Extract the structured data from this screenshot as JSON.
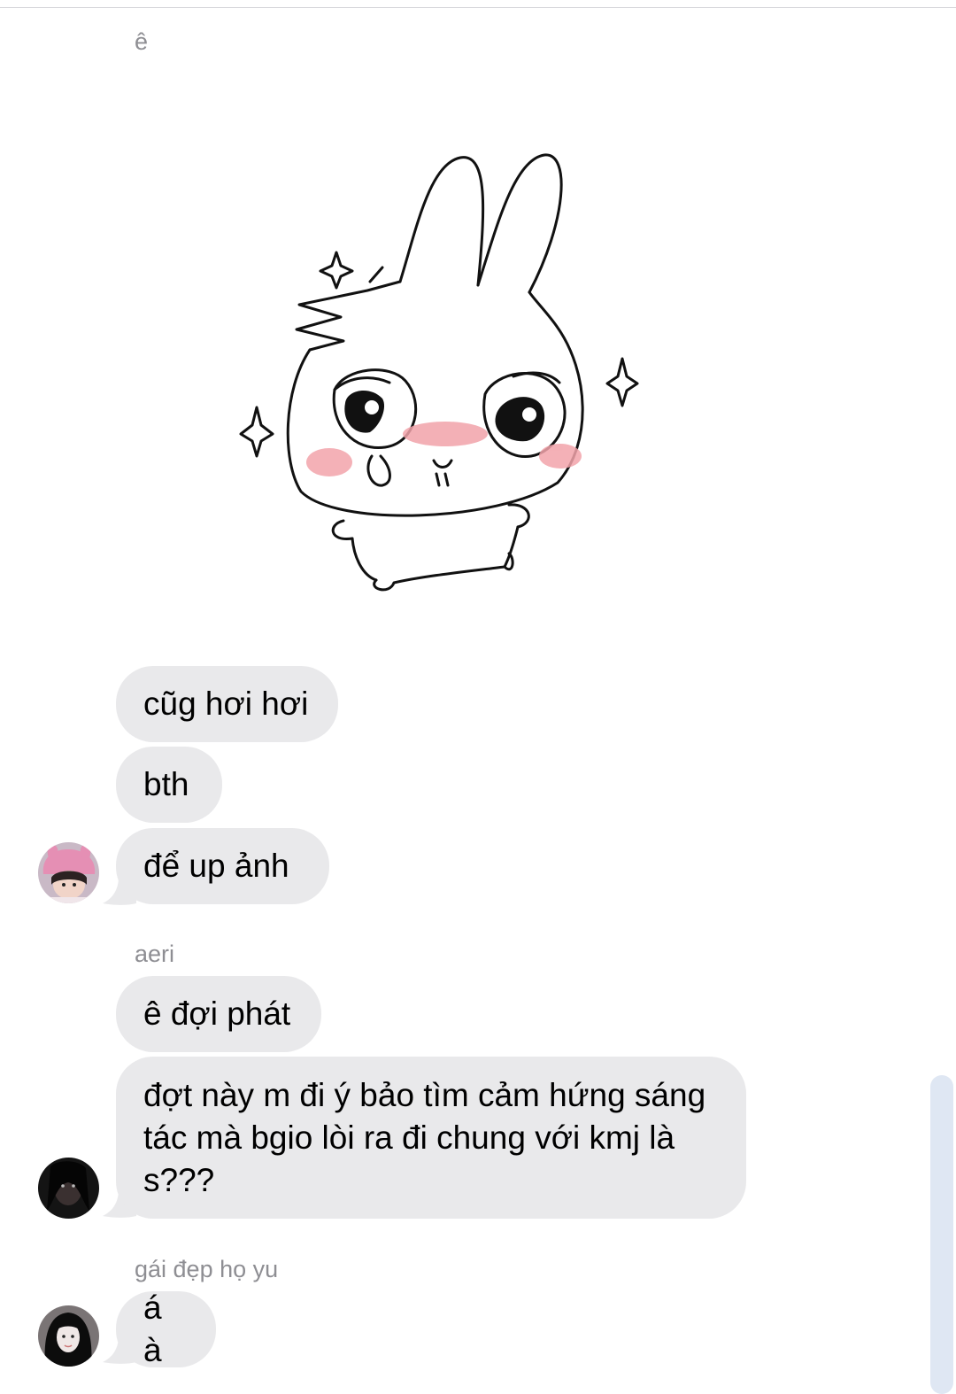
{
  "messages": {
    "group1_sender": "ê",
    "group1": [
      "cũg hơi hơi",
      "bth",
      "để up ảnh"
    ],
    "group2_sender": "aeri",
    "group2": [
      "ê đợi phát",
      "đợt này m đi ý bảo tìm cảm hứng sáng tác mà bgio lòi ra đi chung với kmj là s???"
    ],
    "group3_sender": "gái đẹp họ yu",
    "group3": [
      "á à"
    ]
  },
  "colors": {
    "bubble_received": "#e9e9eb",
    "sender_name": "#8e8e93",
    "background": "#ffffff"
  },
  "icons": {
    "sticker": "bunny-sticker",
    "avatar_1": "avatar-pink-bunny-hat",
    "avatar_2": "avatar-dark-portrait",
    "avatar_3": "avatar-dark-hair-portrait"
  }
}
